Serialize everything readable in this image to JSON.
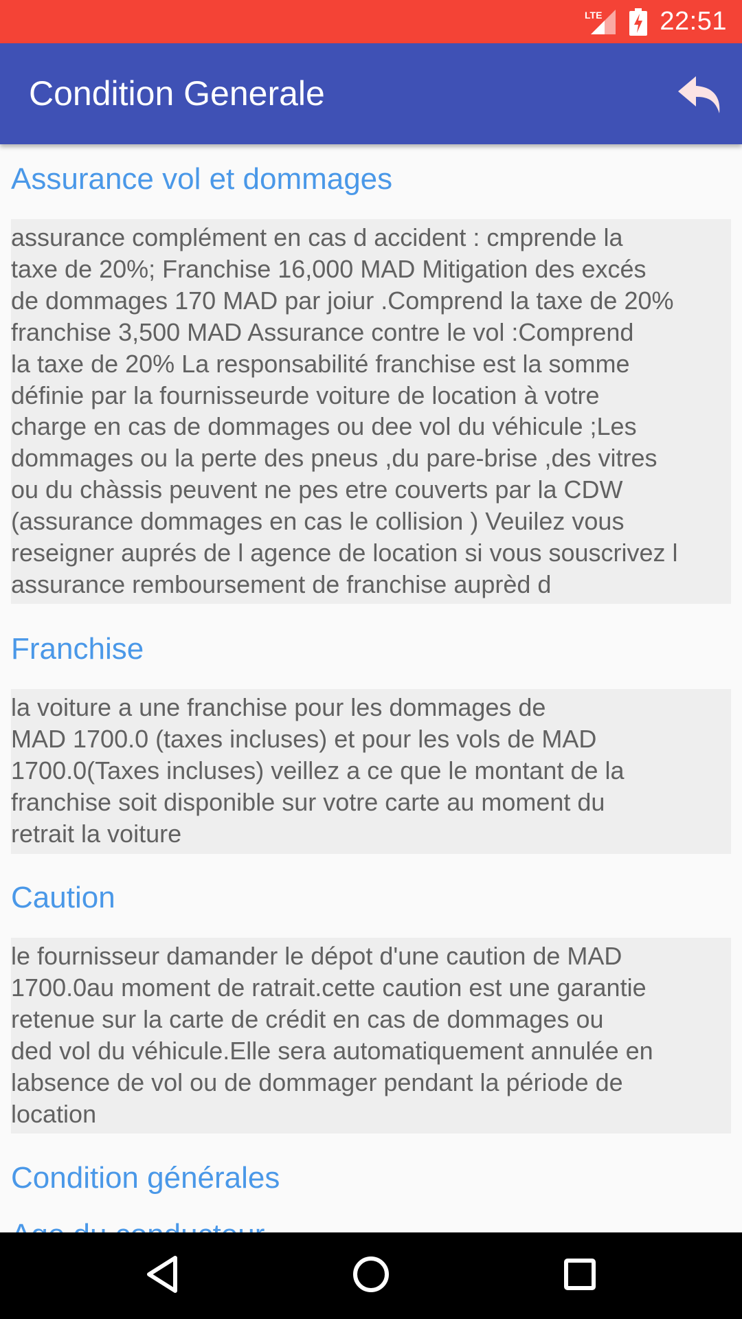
{
  "status_bar": {
    "network_label": "LTE",
    "time": "22:51",
    "color": "#f44336"
  },
  "app_bar": {
    "title": "Condition Generale",
    "back_icon": "reply-arrow-icon",
    "color": "#3f51b5"
  },
  "sections": [
    {
      "title": "Assurance vol et dommages",
      "lines": [
        "assurance complément en cas d accident : cmprende la",
        "taxe de 20%; Franchise 16,000 MAD Mitigation des excés",
        "de dommages 170 MAD par joiur .Comprend la taxe de 20%",
        "franchise 3,500 MAD Assurance contre le vol :Comprend",
        "la taxe de 20% La responsabilité franchise est la somme",
        "définie par la fournisseurde voiture de location à votre",
        "charge en cas de dommages ou dee vol du véhicule ;Les",
        "dommages ou la perte des pneus ,du pare-brise ,des vitres",
        "ou du chàssis peuvent ne pes etre couverts par la CDW",
        "(assurance dommages en cas le collision ) Veuilez vous",
        "reseigner auprés de l agence de location si vous souscrivez l",
        "assurance remboursement de franchise auprèd d"
      ]
    },
    {
      "title": "Franchise",
      "lines": [
        "la voiture a une franchise pour les dommages de",
        "MAD 1700.0 (taxes incluses) et pour les vols de MAD",
        "1700.0(Taxes incluses) veillez a ce que le montant de la",
        "franchise soit disponible sur votre carte au moment du",
        "retrait la voiture"
      ]
    },
    {
      "title": "Caution",
      "lines": [
        "le fournisseur damander le dépot d'une caution de MAD",
        "1700.0au moment de ratrait.cette caution est une garantie",
        "retenue sur la carte de crédit en cas de dommages ou",
        "ded vol du véhicule.Elle sera automatiquement annulée en",
        "labsence de vol ou de dommager pendant la période de",
        "location"
      ]
    },
    {
      "title": "Condition générales"
    },
    {
      "title": "Age du conducteur"
    }
  ],
  "nav_bar": {
    "back_icon": "nav-back-triangle-icon",
    "home_icon": "nav-home-circle-icon",
    "recents_icon": "nav-recents-square-icon"
  },
  "colors": {
    "section_title": "#4a98e8",
    "body_text": "#616161",
    "body_background": "#eeeeee",
    "page_background": "#fafafa"
  }
}
